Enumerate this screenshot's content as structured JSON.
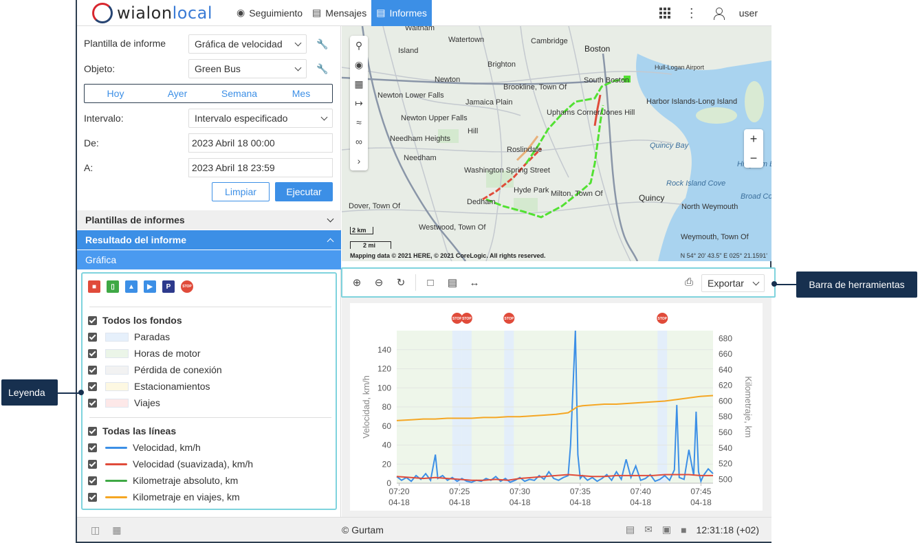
{
  "app": {
    "logo_main": "wialon",
    "logo_accent": "local",
    "nav": [
      {
        "label": "Seguimiento",
        "icon": "globe-icon"
      },
      {
        "label": "Mensajes",
        "icon": "document-icon"
      },
      {
        "label": "Informes",
        "icon": "report-icon",
        "active": true
      }
    ],
    "user_label": "user"
  },
  "form": {
    "template_label": "Plantilla de informe",
    "template_value": "Gráfica de velocidad",
    "object_label": "Objeto:",
    "object_value": "Green Bus",
    "periods": [
      "Hoy",
      "Ayer",
      "Semana",
      "Mes"
    ],
    "interval_label": "Intervalo:",
    "interval_value": "Intervalo especificado",
    "from_label": "De:",
    "from_value": "2023 Abril 18 00:00",
    "to_label": "A:",
    "to_value": "2023 Abril 18 23:59",
    "clear_label": "Limpiar",
    "run_label": "Ejecutar"
  },
  "sections": {
    "templates": "Plantillas de informes",
    "result": "Resultado del informe",
    "graph": "Gráfica"
  },
  "legend": {
    "all_backgrounds": "Todos los fondos",
    "backgrounds": [
      {
        "label": "Paradas",
        "color": "#e6f0fb"
      },
      {
        "label": "Horas de motor",
        "color": "#ebf5e8"
      },
      {
        "label": "Pérdida de conexión",
        "color": "#f2f2f2"
      },
      {
        "label": "Estacionamientos",
        "color": "#fdf8e2"
      },
      {
        "label": "Viajes",
        "color": "#fde8e8"
      }
    ],
    "all_lines": "Todas las líneas",
    "lines": [
      {
        "label": "Velocidad, km/h",
        "color": "#3c8fe6"
      },
      {
        "label": "Velocidad (suavizada), km/h",
        "color": "#e04b3a"
      },
      {
        "label": "Kilometraje absoluto, km",
        "color": "#3fa845"
      },
      {
        "label": "Kilometraje en viajes, km",
        "color": "#f5a623"
      }
    ]
  },
  "map": {
    "attribution": "Mapping data © 2021 HERE, © 2021 CoreLogic. All rights reserved.",
    "coords": "N 54° 20' 43.5\" E 025° 21.1591'",
    "scale_km": "2 km",
    "scale_mi": "2 mi",
    "labels": [
      {
        "text": "Waltham"
      },
      {
        "text": "Watertown"
      },
      {
        "text": "Cambridge"
      },
      {
        "text": "Boston"
      },
      {
        "text": "Island"
      },
      {
        "text": "Brighton"
      },
      {
        "text": "Newton"
      },
      {
        "text": "Brookline, Town Of"
      },
      {
        "text": "South Boston"
      },
      {
        "text": "Hull-Logan Airport"
      },
      {
        "text": "Newton Lower Falls"
      },
      {
        "text": "Harbor Islands-Long Island"
      },
      {
        "text": "Jamaica Plain"
      },
      {
        "text": "Uphams Corner/Jones Hill"
      },
      {
        "text": "Newton Upper Falls"
      },
      {
        "text": "Needham Heights"
      },
      {
        "text": "Hill"
      },
      {
        "text": "Quincy Bay"
      },
      {
        "text": "Roslindale"
      },
      {
        "text": "Needham"
      },
      {
        "text": "Washington Spring Street"
      },
      {
        "text": "Hyde Park"
      },
      {
        "text": "Milton, Town Of"
      },
      {
        "text": "Quincy"
      },
      {
        "text": "Rock Island Cove"
      },
      {
        "text": "Dedham"
      },
      {
        "text": "Dover, Town Of"
      },
      {
        "text": "North Weymouth"
      },
      {
        "text": "Westwood, Town Of"
      },
      {
        "text": "Weymouth, Town Of"
      },
      {
        "text": "Hingham Bay"
      },
      {
        "text": "Broad Cove"
      }
    ]
  },
  "toolbar": {
    "export_label": "Exportar"
  },
  "chart_data": {
    "type": "line",
    "ylabel": "Velocidad, km/h",
    "y2label": "Kilometraje, km",
    "ylim": [
      0,
      160
    ],
    "y2lim": [
      495,
      690
    ],
    "yticks": [
      0,
      20,
      40,
      60,
      80,
      100,
      120,
      140
    ],
    "y2ticks": [
      500,
      520,
      540,
      560,
      580,
      600,
      620,
      640,
      660,
      680
    ],
    "xticks": [
      {
        "time": "07:20",
        "date": "04-18"
      },
      {
        "time": "07:25",
        "date": "04-18"
      },
      {
        "time": "07:30",
        "date": "04-18"
      },
      {
        "time": "07:35",
        "date": "04-18"
      },
      {
        "time": "07:40",
        "date": "04-18"
      },
      {
        "time": "07:45",
        "date": "04-18"
      }
    ],
    "xlim_minutes": [
      19.8,
      46.0
    ],
    "stop_markers_minutes": [
      24.8,
      25.6,
      29.1,
      41.8
    ],
    "stop_icon_text": "STOP",
    "series": [
      {
        "name": "Velocidad, km/h",
        "color": "#3c8fe6",
        "axis": "left",
        "x": [
          19.8,
          20.2,
          20.6,
          21.0,
          21.4,
          21.8,
          22.2,
          22.6,
          23.0,
          23.2,
          23.6,
          24.0,
          24.4,
          24.8,
          25.2,
          25.6,
          26.0,
          26.4,
          26.8,
          27.2,
          27.6,
          28.0,
          28.4,
          28.8,
          29.2,
          29.6,
          30.0,
          30.4,
          30.8,
          31.2,
          31.6,
          32.0,
          32.4,
          32.8,
          33.2,
          33.6,
          34.0,
          34.2,
          34.4,
          34.6,
          34.8,
          35.0,
          35.2,
          35.6,
          36.0,
          36.4,
          36.8,
          37.2,
          37.6,
          38.0,
          38.4,
          38.8,
          39.2,
          39.6,
          40.0,
          40.4,
          40.8,
          41.2,
          41.6,
          42.0,
          42.4,
          42.8,
          43.0,
          43.2,
          43.6,
          44.0,
          44.4,
          44.6,
          44.8,
          45.0,
          45.2,
          45.6,
          46.0
        ],
        "values": [
          7,
          3,
          6,
          2,
          8,
          4,
          10,
          3,
          30,
          5,
          8,
          3,
          6,
          2,
          5,
          2,
          1,
          3,
          2,
          5,
          3,
          7,
          2,
          5,
          1,
          3,
          6,
          2,
          4,
          3,
          8,
          4,
          12,
          5,
          3,
          6,
          8,
          40,
          100,
          160,
          30,
          5,
          8,
          3,
          6,
          2,
          5,
          9,
          3,
          12,
          4,
          25,
          6,
          18,
          3,
          5,
          9,
          2,
          4,
          8,
          3,
          14,
          82,
          6,
          4,
          35,
          8,
          75,
          12,
          2,
          8,
          15,
          10
        ]
      },
      {
        "name": "Velocidad (suavizada), km/h",
        "color": "#e04b3a",
        "axis": "left",
        "x": [
          19.8,
          21.0,
          22.0,
          23.0,
          24.0,
          25.0,
          26.0,
          27.0,
          28.0,
          29.0,
          30.0,
          31.0,
          32.0,
          33.0,
          34.0,
          35.0,
          36.0,
          37.0,
          38.0,
          39.0,
          40.0,
          41.0,
          42.0,
          43.0,
          44.0,
          45.0,
          46.0
        ],
        "values": [
          7,
          6,
          5,
          6,
          5,
          4,
          3,
          3,
          4,
          3,
          5,
          6,
          7,
          8,
          9,
          8,
          7,
          7,
          8,
          8,
          8,
          8,
          9,
          9,
          9,
          8,
          8
        ]
      },
      {
        "name": "Kilometraje en viajes, km",
        "color": "#f5a623",
        "axis": "right",
        "x": [
          19.8,
          21.0,
          22.0,
          23.0,
          24.0,
          25.0,
          26.0,
          27.0,
          28.0,
          29.0,
          30.0,
          31.0,
          32.0,
          33.0,
          34.0,
          34.4,
          34.8,
          35.2,
          36.0,
          37.0,
          38.0,
          39.0,
          40.0,
          41.0,
          42.0,
          43.0,
          44.0,
          45.0,
          46.0
        ],
        "values": [
          575,
          576,
          577,
          577,
          578,
          578,
          578,
          579,
          579,
          580,
          580,
          581,
          582,
          583,
          585,
          589,
          593,
          594,
          595,
          596,
          596,
          597,
          598,
          599,
          600,
          602,
          604,
          606,
          607
        ]
      }
    ]
  },
  "footer": {
    "copyright": "© Gurtam",
    "time": "12:31:18 (+02)"
  },
  "callouts": {
    "legend": "Leyenda",
    "toolbar": "Barra de herramientas"
  }
}
